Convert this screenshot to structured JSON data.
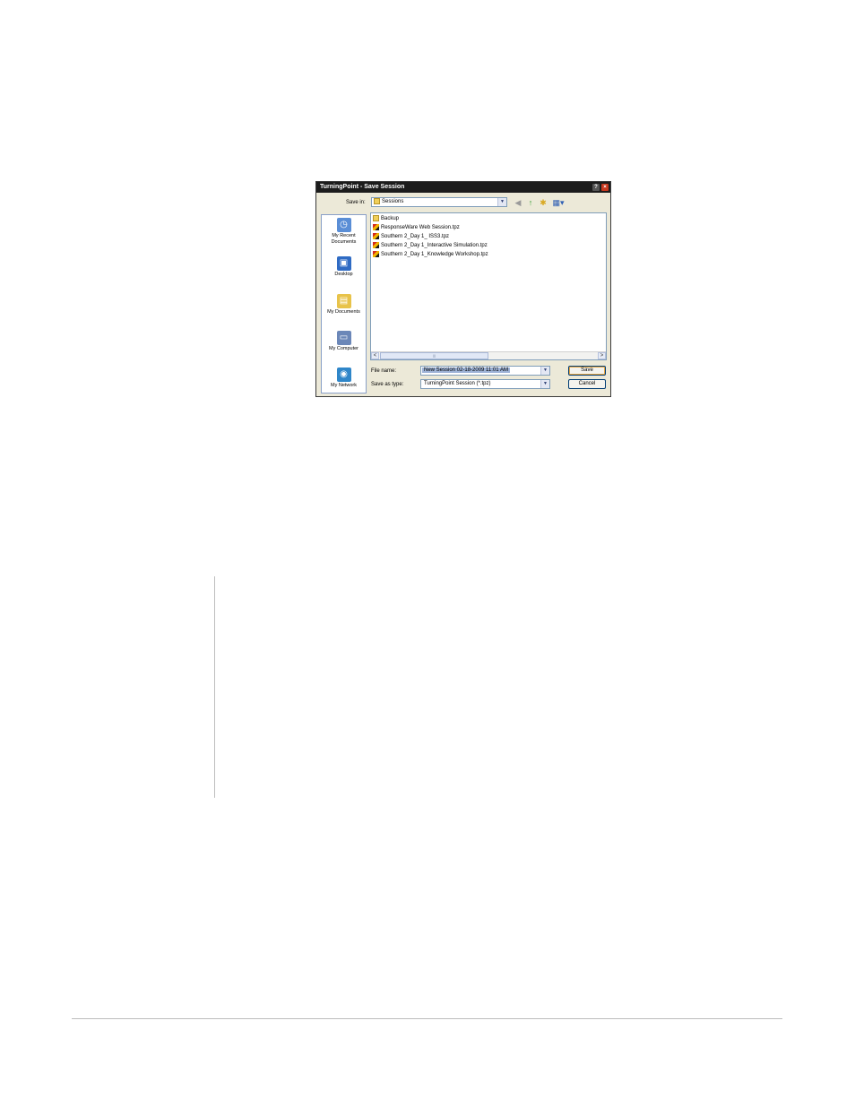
{
  "dialog": {
    "title": "TurningPoint - Save Session",
    "help_glyph": "?",
    "close_glyph": "×",
    "save_in_label": "Save in:",
    "save_in_value": "Sessions",
    "toolbar": {
      "back_glyph": "◀",
      "up_glyph": "↑",
      "new_folder_glyph": "✱",
      "views_glyph": "▦▾"
    },
    "places": [
      {
        "label": "My Recent Documents",
        "icon": "recent-documents-icon",
        "glyph": "◷",
        "color": "#5a8ed6"
      },
      {
        "label": "Desktop",
        "icon": "desktop-icon",
        "glyph": "▣",
        "color": "#2f6bc4"
      },
      {
        "label": "My Documents",
        "icon": "my-documents-icon",
        "glyph": "▤",
        "color": "#e8c34a"
      },
      {
        "label": "My Computer",
        "icon": "my-computer-icon",
        "glyph": "▭",
        "color": "#6b87b8"
      },
      {
        "label": "My Network",
        "icon": "my-network-icon",
        "glyph": "◉",
        "color": "#2f86c9"
      }
    ],
    "files": [
      {
        "name": "Backup",
        "type": "folder"
      },
      {
        "name": "ResponseWare Web Session.tpz",
        "type": "tpz"
      },
      {
        "name": "Southern 2_Day 1_ ISS3.tpz",
        "type": "tpz"
      },
      {
        "name": "Southern 2_Day 1_Interactive Simulation.tpz",
        "type": "tpz"
      },
      {
        "name": "Southern 2_Day 1_Knowledge Workshop.tpz",
        "type": "tpz"
      }
    ],
    "scroll_left": "<",
    "scroll_right": ">",
    "scroll_grip": "|||",
    "file_name_label": "File name:",
    "file_name_value": "New Session 02-18-2009 11:01 AM",
    "save_type_label": "Save as type:",
    "save_type_value": "TurningPoint Session (*.tpz)",
    "save_button": "Save",
    "cancel_button": "Cancel",
    "dropdown_glyph": "▼"
  }
}
